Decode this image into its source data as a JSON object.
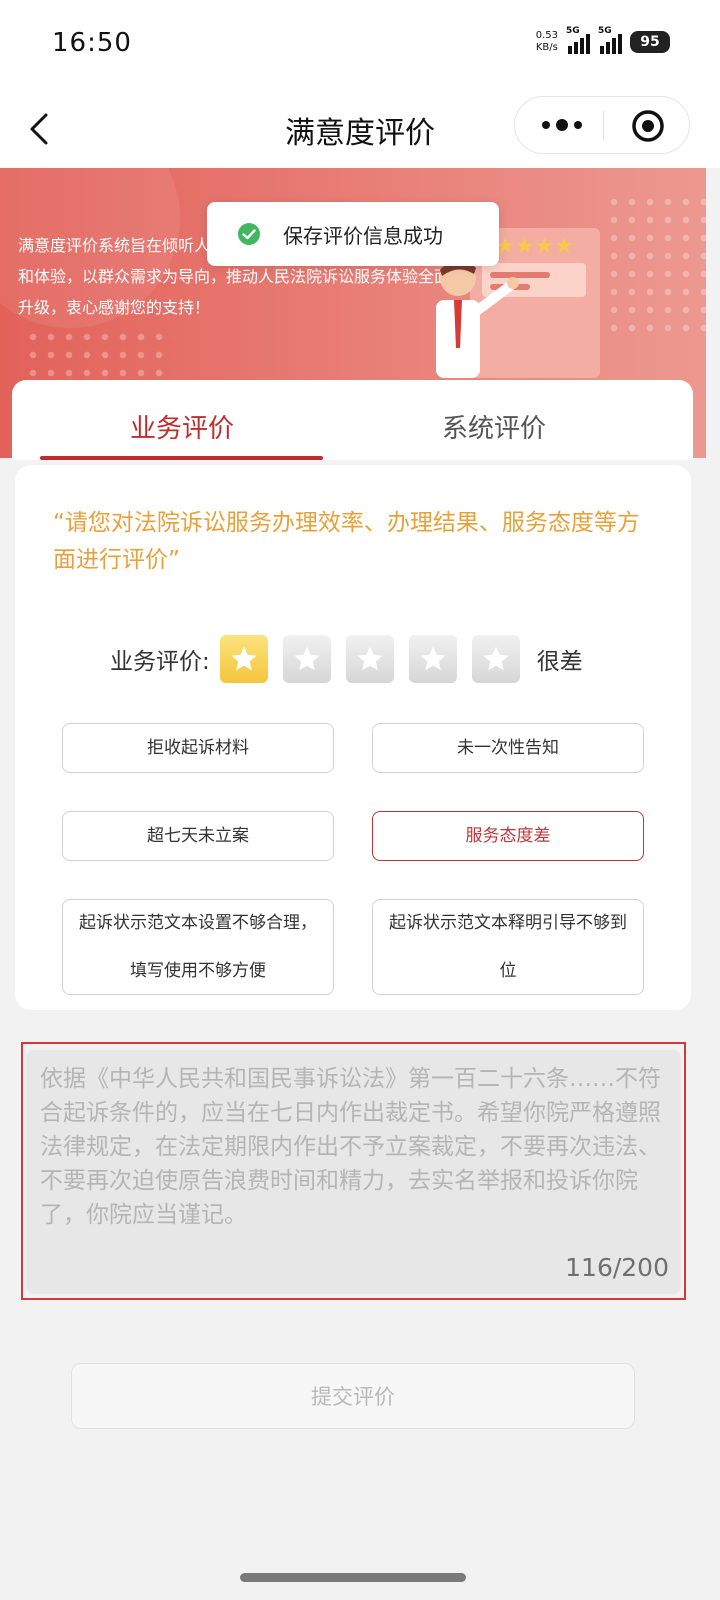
{
  "status_bar": {
    "time": "16:50",
    "speed_value": "0.53",
    "speed_unit": "KB/s",
    "sim1": "5G",
    "sim2": "5G",
    "battery": "95"
  },
  "nav": {
    "title": "满意度评价",
    "back_icon": "chevron-left-icon",
    "more_icon": "more-dots-icon",
    "close_icon": "target-icon"
  },
  "banner": {
    "text": "满意度评价系统旨在倾听人民群众对法院诉讼服务的真实感受和体验，以群众需求为导向，推动人民法院诉讼服务体验全面升级，衷心感谢您的支持！",
    "colors": {
      "start": "#e2625a",
      "end": "#ec9990"
    }
  },
  "toast": {
    "icon": "check-circle-icon",
    "text": "保存评价信息成功"
  },
  "tabs": [
    {
      "label": "业务评价",
      "active": true
    },
    {
      "label": "系统评价",
      "active": false
    }
  ],
  "evaluation": {
    "prompt": "“请您对法院诉讼服务办理效率、办理结果、服务态度等方面进行评价”",
    "rating_label": "业务评价:",
    "rating": 1,
    "rating_max": 5,
    "rating_text": "很差",
    "tags": [
      {
        "label": "拒收起诉材料",
        "selected": false
      },
      {
        "label": "未一次性告知",
        "selected": false
      },
      {
        "label": "超七天未立案",
        "selected": false
      },
      {
        "label": "服务态度差",
        "selected": true
      },
      {
        "label": "起诉状示范文本设置不够合理，填写使用不够方便",
        "selected": false
      },
      {
        "label": "起诉状示范文本释明引导不够到位",
        "selected": false
      }
    ]
  },
  "feedback": {
    "text": "依据《中华人民共和国民事诉讼法》第一百二十六条……不符合起诉条件的，应当在七日内作出裁定书。希望你院严格遵照法律规定，在法定期限内作出不予立案裁定，不要再次违法、不要再次迫使原告浪费时间和精力，去实名举报和投诉你院了，你院应当谨记。",
    "count": "116/200"
  },
  "submit_label": "提交评价",
  "colors": {
    "accent": "#c02c2c",
    "prompt": "#e8a13a",
    "star_on": "#f5c53c",
    "highlight_border": "#d23a3a"
  }
}
